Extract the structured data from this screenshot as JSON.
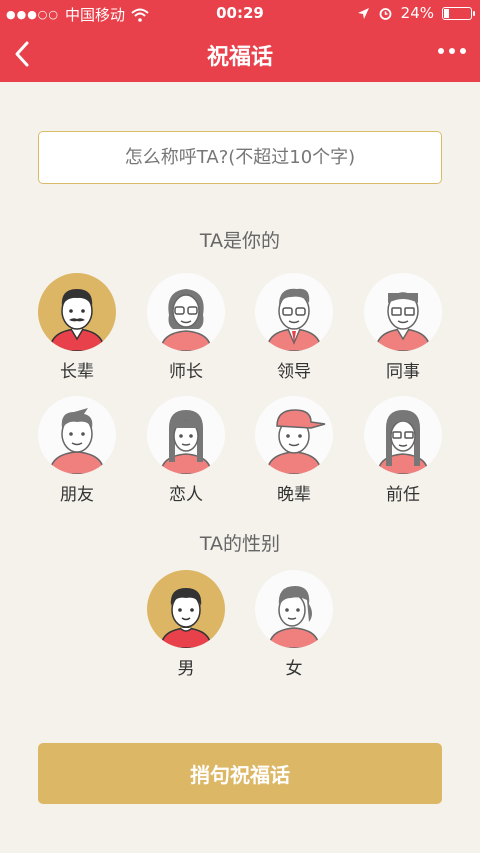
{
  "status_bar": {
    "carrier": "中国移动",
    "time": "00:29",
    "battery": "24%",
    "battery_level": 0.24
  },
  "nav": {
    "title": "祝福话",
    "back_icon": "chevron-left-icon",
    "more_icon": "more-dots-icon"
  },
  "name_input": {
    "placeholder": "怎么称呼TA?(不超过10个字)",
    "value": ""
  },
  "relation_section": {
    "title": "TA是你的",
    "items": [
      {
        "label": "长辈",
        "icon": "elder-avatar-icon",
        "selected": true
      },
      {
        "label": "师长",
        "icon": "teacher-avatar-icon",
        "selected": false
      },
      {
        "label": "领导",
        "icon": "leader-avatar-icon",
        "selected": false
      },
      {
        "label": "同事",
        "icon": "colleague-avatar-icon",
        "selected": false
      },
      {
        "label": "朋友",
        "icon": "friend-avatar-icon",
        "selected": false
      },
      {
        "label": "恋人",
        "icon": "lover-avatar-icon",
        "selected": false
      },
      {
        "label": "晚辈",
        "icon": "junior-avatar-icon",
        "selected": false
      },
      {
        "label": "前任",
        "icon": "ex-avatar-icon",
        "selected": false
      }
    ]
  },
  "gender_section": {
    "title": "TA的性别",
    "items": [
      {
        "label": "男",
        "icon": "male-avatar-icon",
        "selected": true
      },
      {
        "label": "女",
        "icon": "female-avatar-icon",
        "selected": false
      }
    ]
  },
  "submit_button": {
    "label": "捎句祝福话"
  },
  "colors": {
    "header": "#e8414b",
    "accent_gold": "#dcb664",
    "background": "#f5f2ec",
    "avatar_shirt": "#f0807e"
  }
}
